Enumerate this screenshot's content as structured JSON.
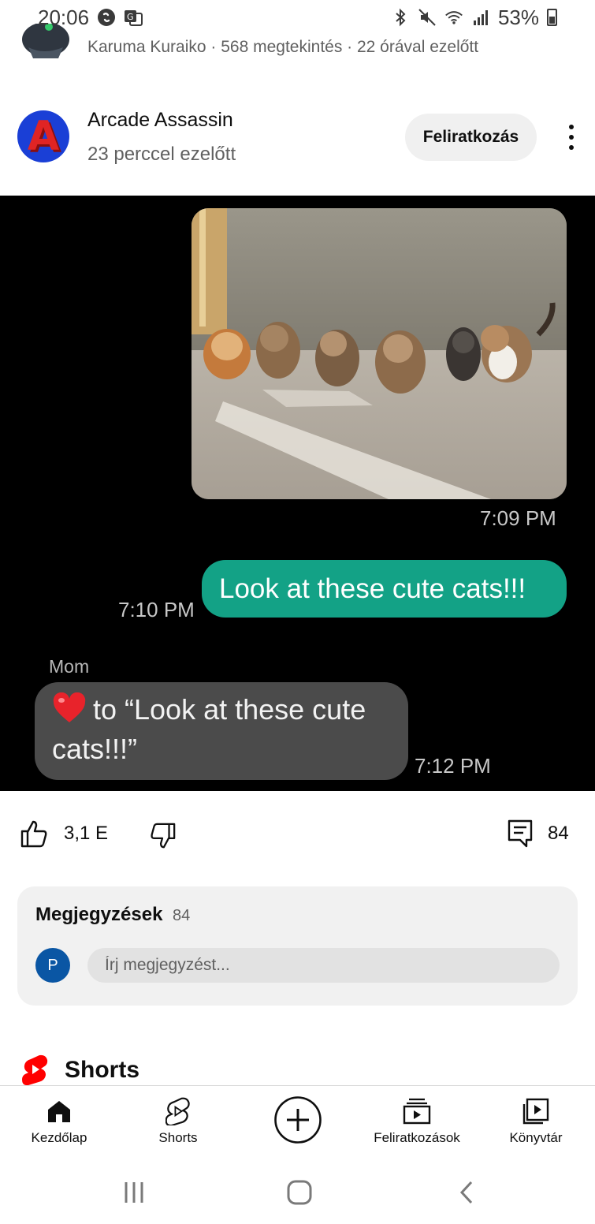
{
  "status_bar": {
    "time": "20:06",
    "battery": "53%",
    "icons": [
      "shazam-icon",
      "translate-icon",
      "bluetooth-icon",
      "mute-icon",
      "wifi-icon",
      "signal-icon",
      "battery-icon"
    ]
  },
  "previous_item": {
    "meta": "Karuma Kuraiko · 568 megtekintés · 22 órával ezelőtt"
  },
  "post": {
    "channel_name": "Arcade Assassin",
    "avatar_letter": "A",
    "time_ago": "23 perccel ezelőtt",
    "subscribe_label": "Feliratkozás",
    "image": {
      "photo_time": "7:09 PM",
      "sent_time": "7:10 PM",
      "sent_message": "Look at these cute cats!!!",
      "sender": "Mom",
      "reaction_line1": "to “Look at these cute",
      "reaction_line2": "cats!!!”",
      "reaction_time": "7:12 PM"
    }
  },
  "actions": {
    "likes": "3,1 E",
    "comments": "84"
  },
  "comments_card": {
    "title": "Megjegyzések",
    "count": "84",
    "user_initial": "P",
    "placeholder": "Írj megjegyzést..."
  },
  "shorts": {
    "title": "Shorts"
  },
  "bottom_nav": {
    "home": "Kezdőlap",
    "shorts": "Shorts",
    "subscriptions": "Feliratkozások",
    "library": "Könyvtár"
  },
  "colors": {
    "accent_red": "#ff0000",
    "sent_bubble": "#13a286",
    "received_bubble": "#4b4b4b"
  }
}
